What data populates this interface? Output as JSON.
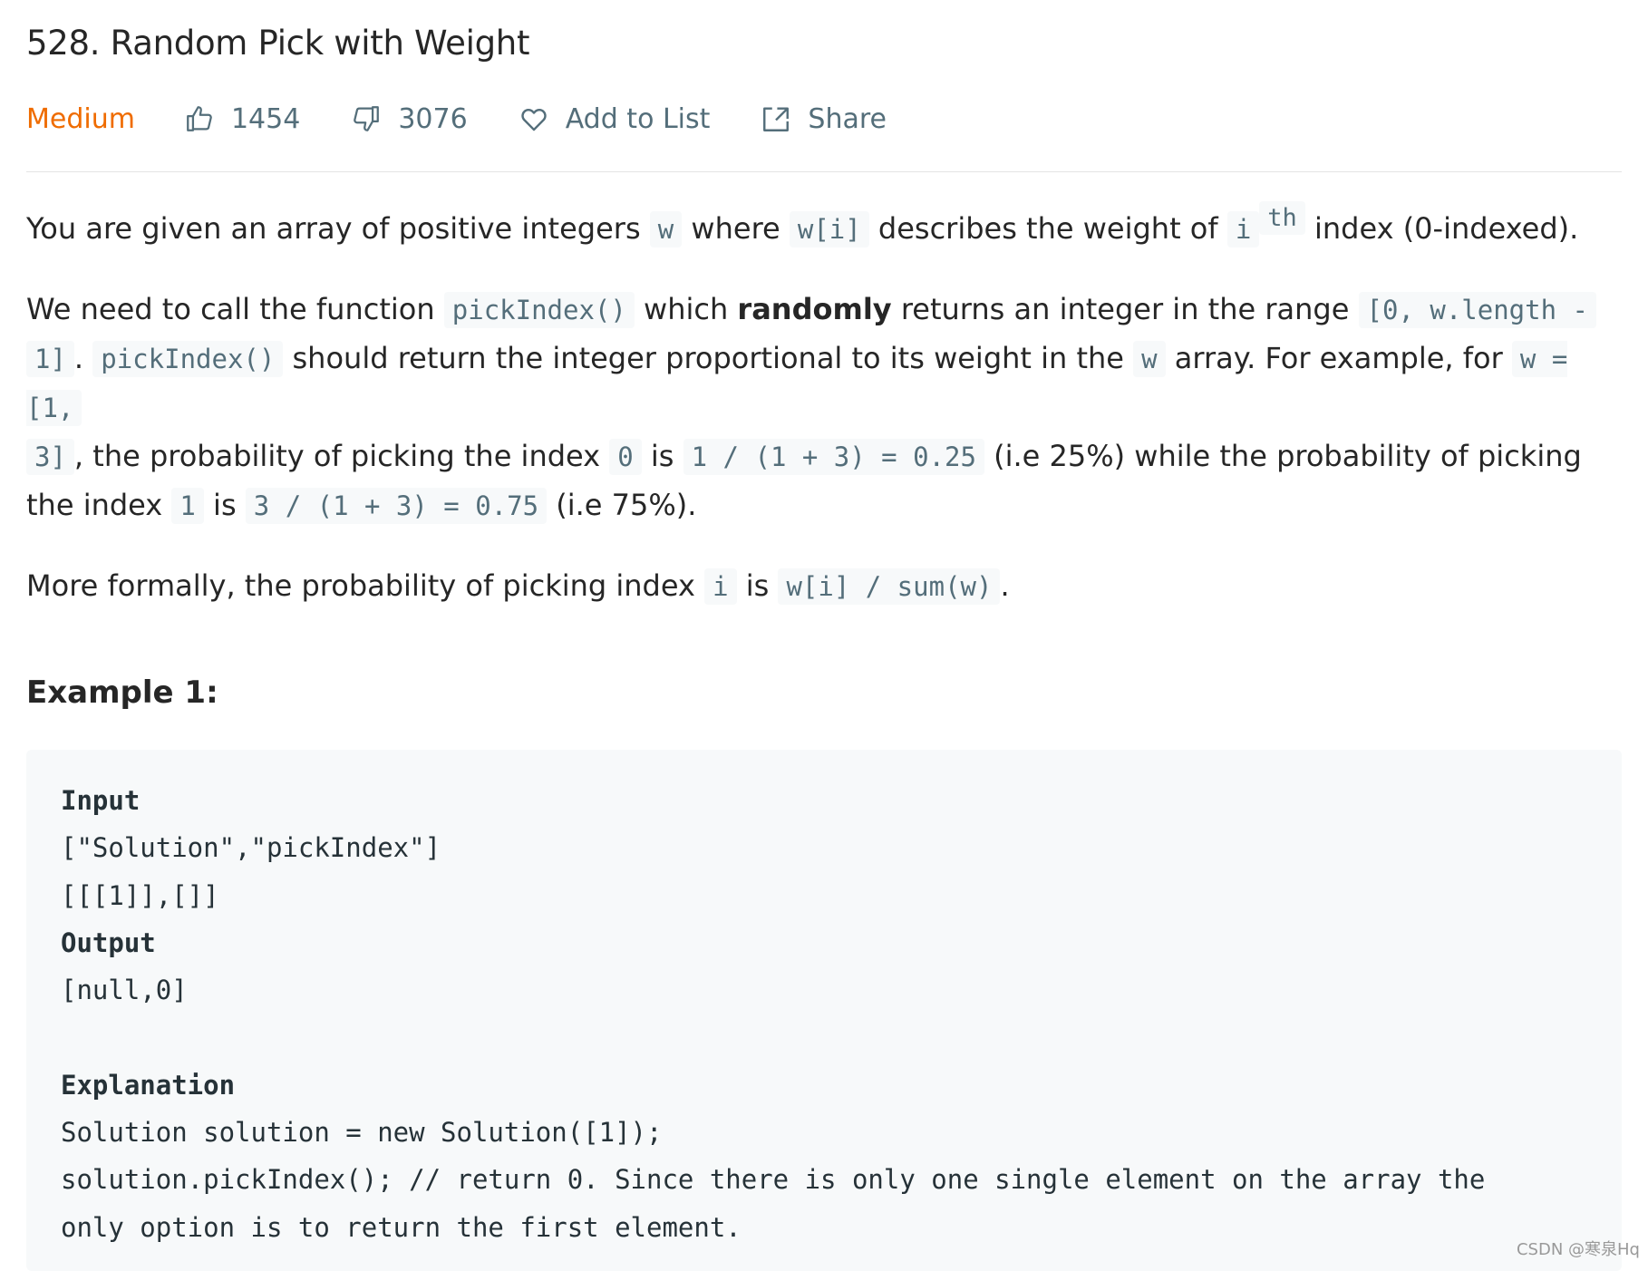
{
  "problem": {
    "title": "528. Random Pick with Weight",
    "difficulty": "Medium",
    "likes": "1454",
    "dislikes": "3076",
    "add_to_list_label": "Add to List",
    "share_label": "Share"
  },
  "colors": {
    "difficulty_medium": "#ef6c00",
    "meta_text": "#546e7a",
    "code_bg": "#f7f9fa"
  },
  "icons": {
    "likes": "thumbs-up-icon",
    "dislikes": "thumbs-down-icon",
    "add_to_list": "heart-icon",
    "share": "share-icon"
  },
  "description": {
    "p1": {
      "t1": "You are given an array of positive integers ",
      "c1": "w",
      "t2": " where ",
      "c2": "w[i]",
      "t3": " describes the weight of ",
      "c3": "i",
      "sup": "th",
      "t4": " index (0-indexed)."
    },
    "p2": {
      "t1": "We need to call the function ",
      "c1": "pickIndex()",
      "t2": " which ",
      "bold": "randomly",
      "t3": " returns an integer in the range ",
      "c2a": "[0, w.length -",
      "c2b": "1]",
      "t4": ". ",
      "c3": "pickIndex()",
      "t5": " should return the integer proportional to its weight in the ",
      "c4": "w",
      "t6": " array. For example, for ",
      "c5a": "w = [1,",
      "c5b": "3]",
      "t7": ", the probability of picking the index ",
      "c6": "0",
      "t8": " is ",
      "c7": "1 / (1 + 3) = 0.25",
      "t9": " (i.e 25%) while the probability of picking the index ",
      "c8": "1",
      "t10": " is ",
      "c9": "3 / (1 + 3) = 0.75",
      "t11": " (i.e 75%)."
    },
    "p3": {
      "t1": "More formally, the probability of picking index ",
      "c1": "i",
      "t2": " is ",
      "c2": "w[i] / sum(w)",
      "t3": "."
    }
  },
  "example": {
    "title": "Example 1:",
    "input_label": "Input",
    "input_line1": "[\"Solution\",\"pickIndex\"]",
    "input_line2": "[[[1]],[]]",
    "output_label": "Output",
    "output_line": "[null,0]",
    "explanation_label": "Explanation",
    "explanation_line1": "Solution solution = new Solution([1]);",
    "explanation_line2": "solution.pickIndex(); // return 0. Since there is only one single element on the array the",
    "explanation_line3": "only option is to return the first element."
  },
  "watermark": "CSDN @寒泉Hq"
}
